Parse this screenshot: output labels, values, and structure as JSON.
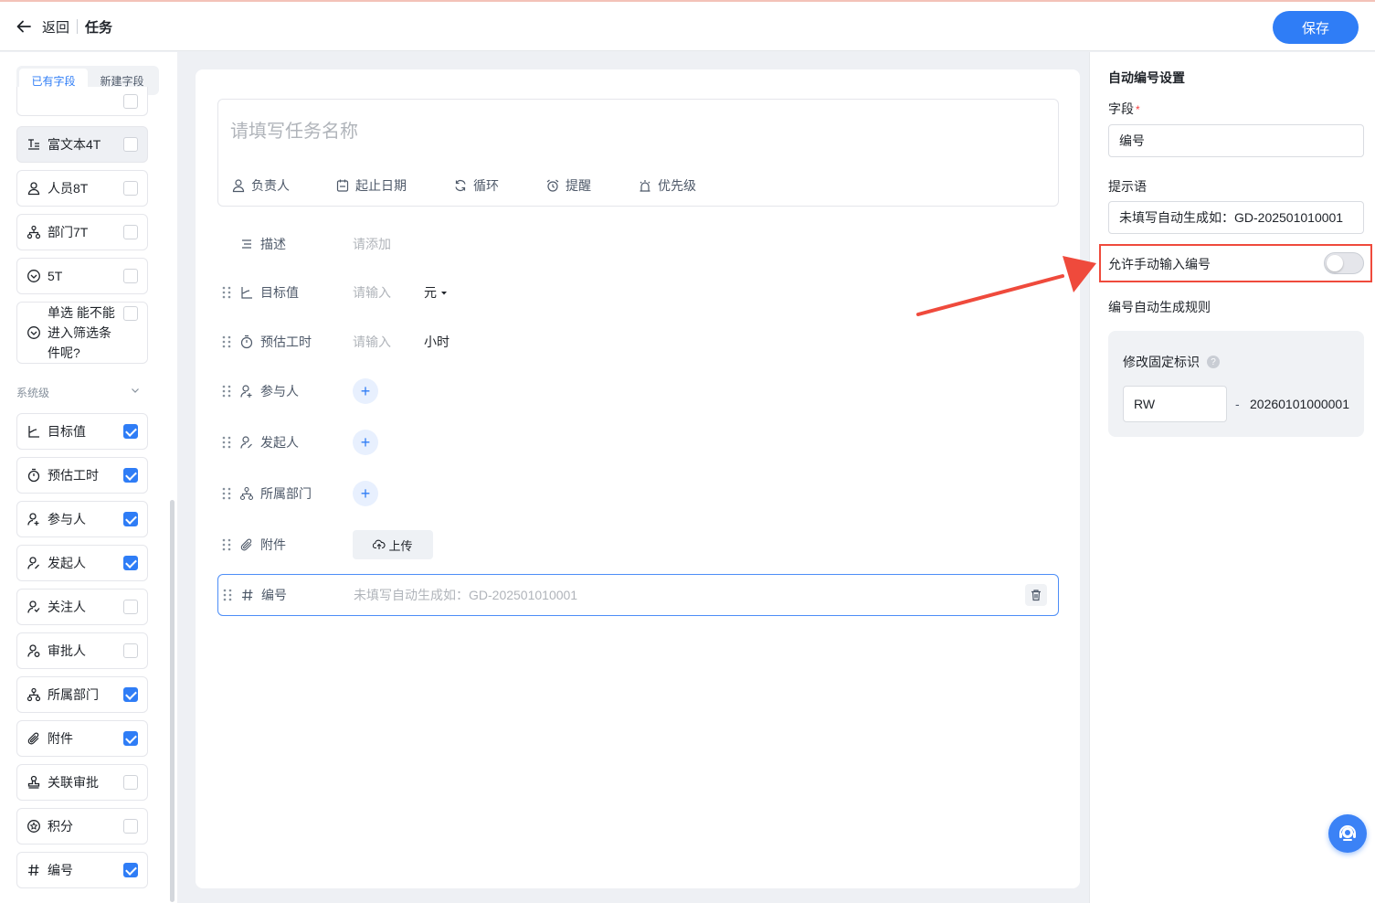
{
  "topbar": {
    "back_label": "返回",
    "title": "任务",
    "save_label": "保存"
  },
  "sidebar": {
    "tabs": [
      {
        "label": "已有字段",
        "active": true
      },
      {
        "label": "新建字段",
        "active": false
      }
    ],
    "custom_items": [
      {
        "label": "富文本4T",
        "icon": "rich-text-icon",
        "checked": false
      },
      {
        "label": "人员8T",
        "icon": "person-icon",
        "checked": false
      },
      {
        "label": "部门7T",
        "icon": "department-icon",
        "checked": false
      },
      {
        "label": "5T",
        "icon": "select-icon",
        "checked": false
      },
      {
        "label": "单选 能不能进入筛选条件呢?",
        "icon": "select-icon",
        "checked": false
      }
    ],
    "group_label": "系统级",
    "system_items": [
      {
        "label": "目标值",
        "icon": "target-icon",
        "checked": true
      },
      {
        "label": "预估工时",
        "icon": "timer-icon",
        "checked": true
      },
      {
        "label": "参与人",
        "icon": "participant-icon",
        "checked": true
      },
      {
        "label": "发起人",
        "icon": "initiator-icon",
        "checked": true
      },
      {
        "label": "关注人",
        "icon": "follower-icon",
        "checked": false
      },
      {
        "label": "审批人",
        "icon": "approver-icon",
        "checked": false
      },
      {
        "label": "所属部门",
        "icon": "department-icon",
        "checked": true
      },
      {
        "label": "附件",
        "icon": "attachment-icon",
        "checked": true
      },
      {
        "label": "关联审批",
        "icon": "stamp-icon",
        "checked": false
      },
      {
        "label": "积分",
        "icon": "points-icon",
        "checked": false
      },
      {
        "label": "编号",
        "icon": "hash-icon",
        "checked": true
      }
    ]
  },
  "main": {
    "task_name_placeholder": "请填写任务名称",
    "quick_actions": [
      {
        "label": "负责人",
        "icon": "person-icon"
      },
      {
        "label": "起止日期",
        "icon": "calendar-icon"
      },
      {
        "label": "循环",
        "icon": "repeat-icon"
      },
      {
        "label": "提醒",
        "icon": "alarm-icon"
      },
      {
        "label": "优先级",
        "icon": "priority-icon"
      }
    ],
    "rows": {
      "description": {
        "label": "描述",
        "placeholder": "请添加"
      },
      "target": {
        "label": "目标值",
        "placeholder": "请输入",
        "unit": "元"
      },
      "estimate": {
        "label": "预估工时",
        "placeholder": "请输入",
        "unit": "小时"
      },
      "participant": {
        "label": "参与人",
        "add": "+"
      },
      "initiator": {
        "label": "发起人",
        "add": "+"
      },
      "department": {
        "label": "所属部门",
        "add": "+"
      },
      "attachment": {
        "label": "附件",
        "upload": "上传"
      },
      "number": {
        "label": "编号",
        "placeholder": "未填写自动生成如：GD-202501010001"
      }
    }
  },
  "right_panel": {
    "title": "自动编号设置",
    "field_label": "字段",
    "field_required": "*",
    "field_value": "编号",
    "hint_label": "提示语",
    "hint_value": "未填写自动生成如：GD-202501010001",
    "manual_input_label": "允许手动输入编号",
    "manual_input_enabled": false,
    "rule_label": "编号自动生成规则",
    "fixed_prefix_label": "修改固定标识",
    "help_mark": "?",
    "prefix_value": "RW",
    "separator": "-",
    "number_sample": "20260101000001"
  },
  "colors": {
    "accent": "#2f7df6",
    "highlight_red": "#ef4a3c"
  }
}
